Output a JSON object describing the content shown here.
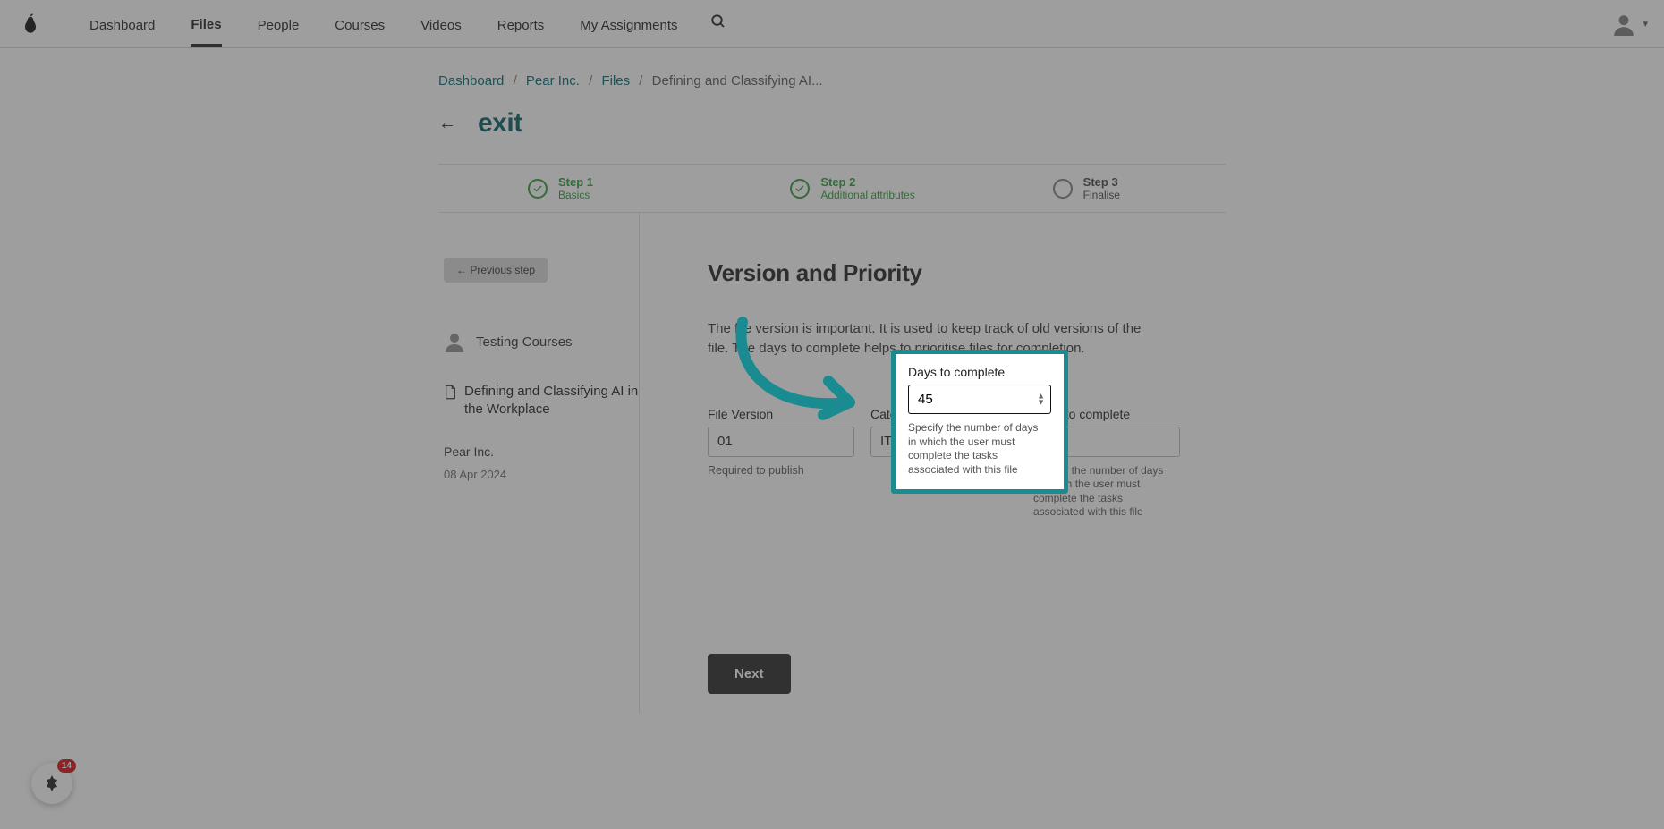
{
  "nav": {
    "items": [
      "Dashboard",
      "Files",
      "People",
      "Courses",
      "Videos",
      "Reports",
      "My Assignments"
    ],
    "active_index": 1
  },
  "crumbs": {
    "a": "Dashboard",
    "b": "Pear Inc.",
    "c": "Files",
    "current": "Defining and Classifying AI..."
  },
  "exit": {
    "label": "exit"
  },
  "steps": [
    {
      "num": "Step 1",
      "label": "Basics"
    },
    {
      "num": "Step 2",
      "label": "Additional attributes"
    },
    {
      "num": "Step 3",
      "label": "Finalise"
    }
  ],
  "side": {
    "prev_button": "← Previous step",
    "user": "Testing Courses",
    "file_title": "Defining and Classifying AI in the Workplace",
    "org": "Pear Inc.",
    "date": "08 Apr 2024"
  },
  "section": {
    "heading": "Version and Priority",
    "desc": "The file version is important. It is used to keep track of old versions of the file. The days to complete helps to prioritise files for completion."
  },
  "form": {
    "version_label": "File Version",
    "version_value": "01",
    "version_hint": "Required to publish",
    "category_label": "Category",
    "category_value": "IT",
    "days_label": "Days to complete",
    "days_value": "45",
    "days_hint": "Specify the number of days in which the user must complete the tasks associated with this file"
  },
  "next_button": "Next",
  "widget": {
    "badge": "14"
  }
}
